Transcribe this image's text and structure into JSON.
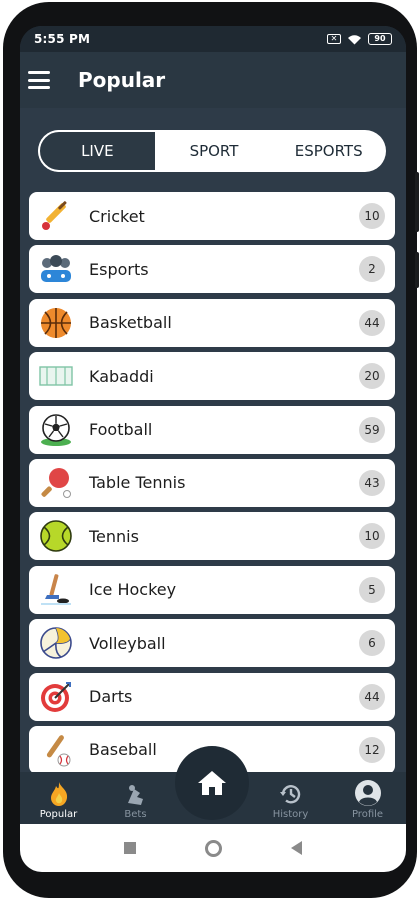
{
  "status": {
    "time": "5:55 PM",
    "battery": "90"
  },
  "appbar": {
    "title": "Popular"
  },
  "tabs": [
    {
      "label": "LIVE",
      "active": true
    },
    {
      "label": "SPORT",
      "active": false
    },
    {
      "label": "ESPORTS",
      "active": false
    }
  ],
  "sports": [
    {
      "name": "Cricket",
      "count": "10",
      "icon": "cricket-icon"
    },
    {
      "name": "Esports",
      "count": "2",
      "icon": "esports-icon"
    },
    {
      "name": "Basketball",
      "count": "44",
      "icon": "basketball-icon"
    },
    {
      "name": "Kabaddi",
      "count": "20",
      "icon": "kabaddi-icon"
    },
    {
      "name": "Football",
      "count": "59",
      "icon": "football-icon"
    },
    {
      "name": "Table Tennis",
      "count": "43",
      "icon": "table-tennis-icon"
    },
    {
      "name": "Tennis",
      "count": "10",
      "icon": "tennis-icon"
    },
    {
      "name": "Ice Hockey",
      "count": "5",
      "icon": "ice-hockey-icon"
    },
    {
      "name": "Volleyball",
      "count": "6",
      "icon": "volleyball-icon"
    },
    {
      "name": "Darts",
      "count": "44",
      "icon": "darts-icon"
    },
    {
      "name": "Baseball",
      "count": "12",
      "icon": "baseball-icon"
    }
  ],
  "nav": {
    "popular": "Popular",
    "bets": "Bets",
    "history": "History",
    "profile": "Profile"
  },
  "colors": {
    "background": "#2e3b48",
    "appbar": "#2a3742",
    "badge": "#d8d8d8"
  }
}
